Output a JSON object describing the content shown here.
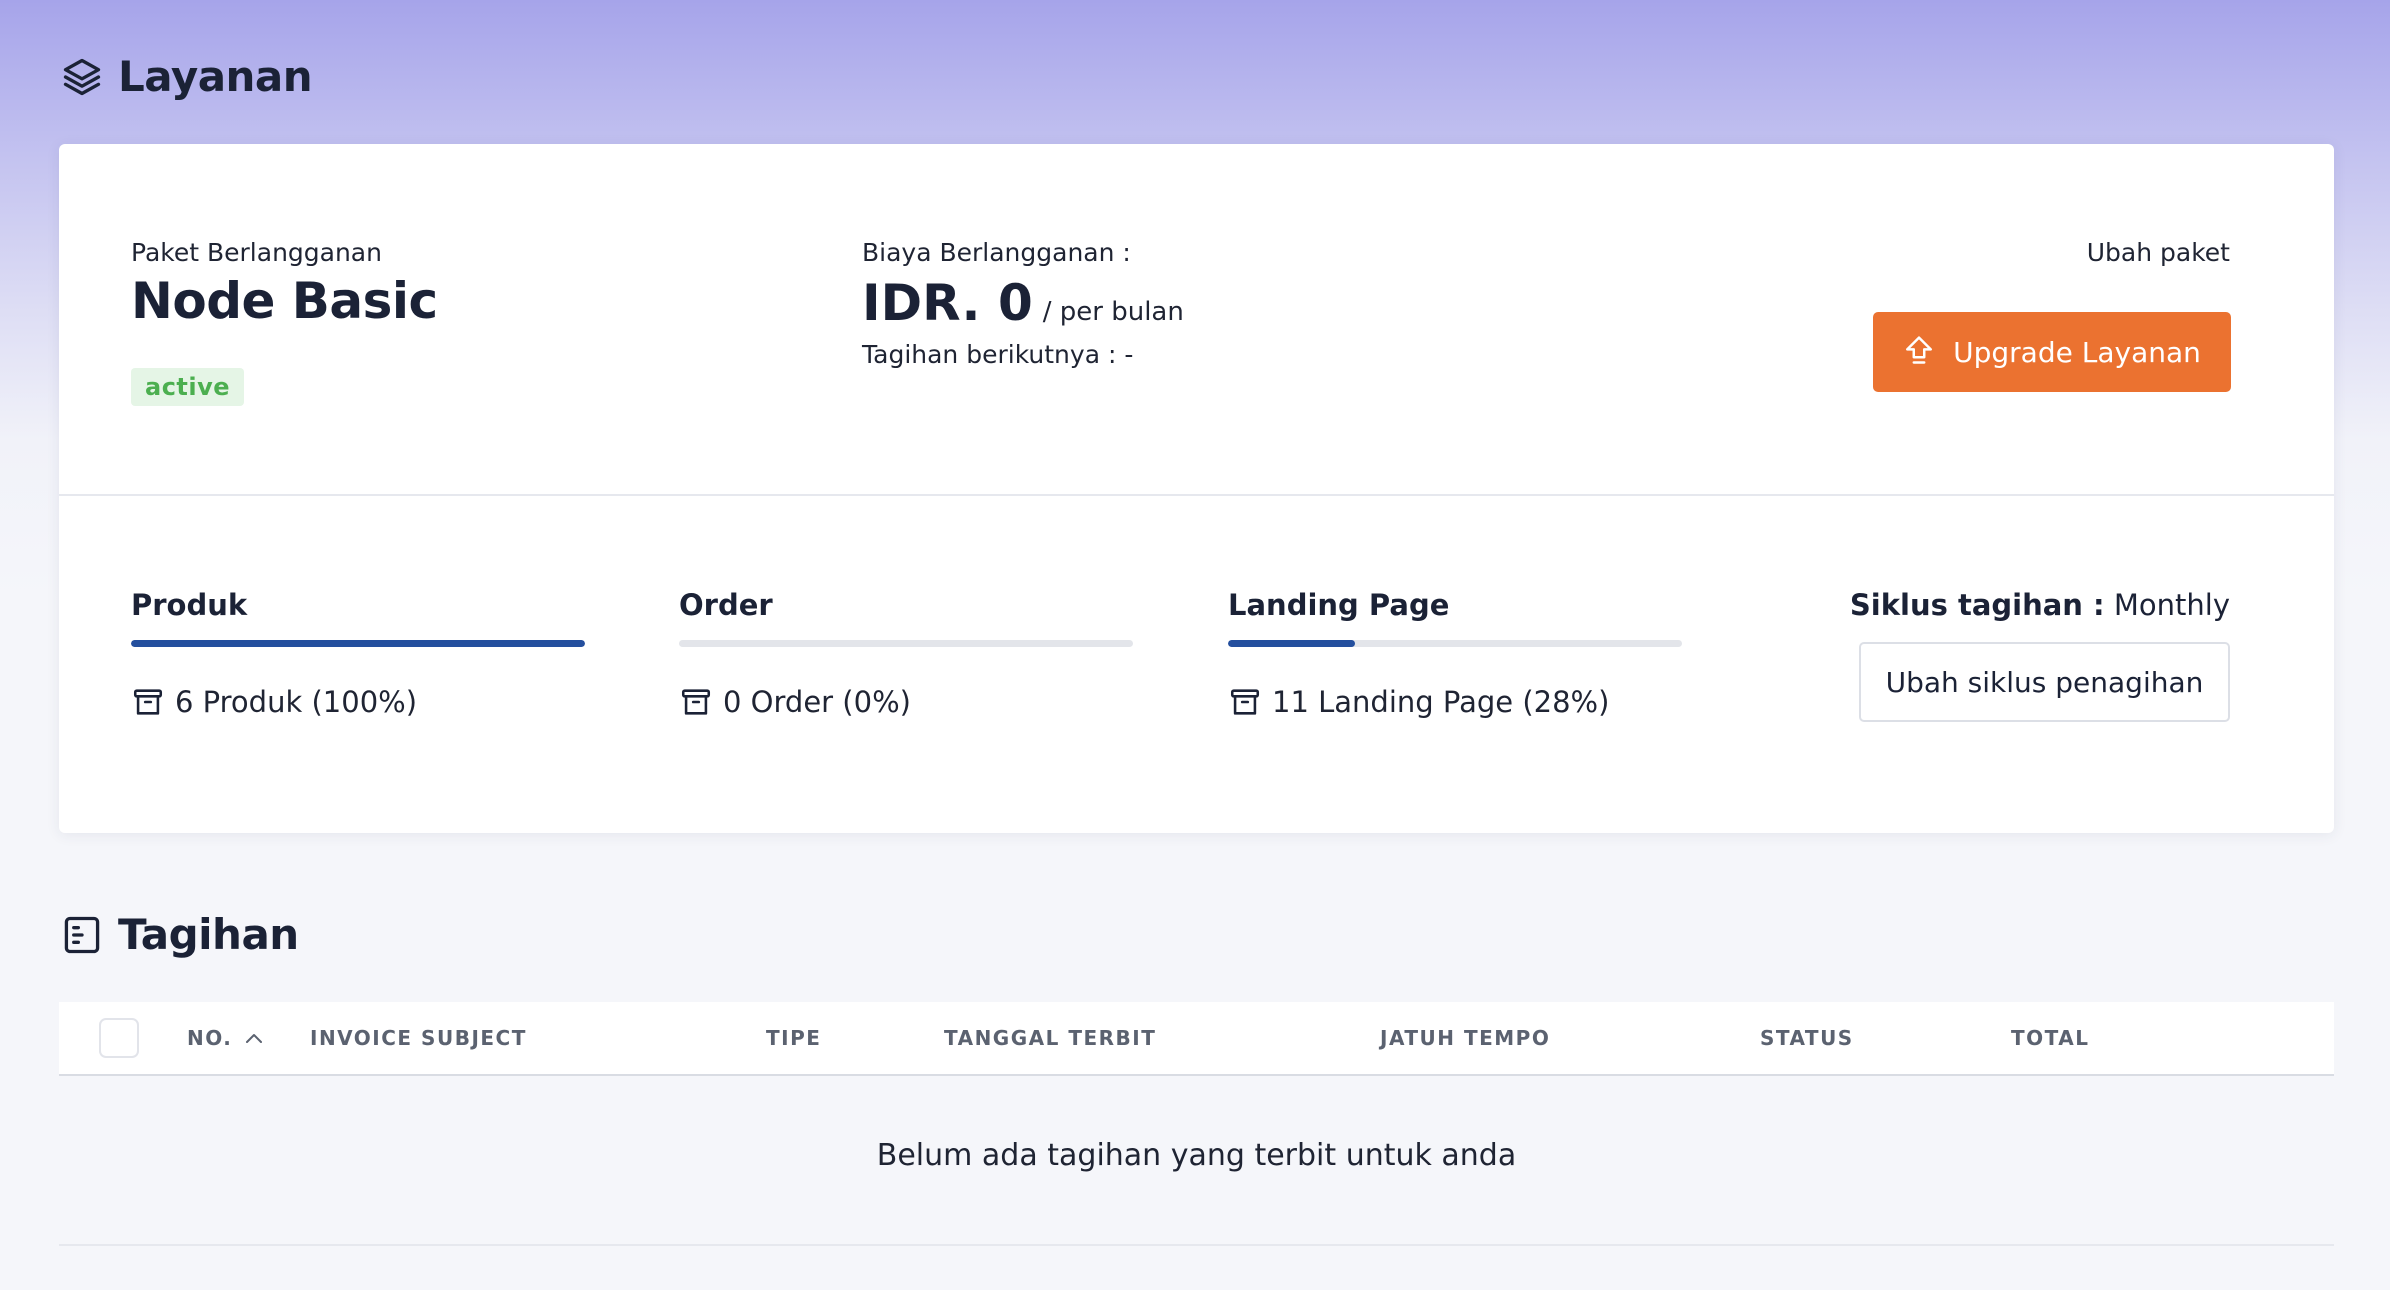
{
  "layanan": {
    "title": "Layanan",
    "plan_label": "Paket Berlangganan",
    "plan_name": "Node Basic",
    "status": "active",
    "fee_label": "Biaya Berlangganan :",
    "price": "IDR. 0",
    "period": "/ per bulan",
    "next_bill": "Tagihan berikutnya : -",
    "change_plan_label": "Ubah paket",
    "upgrade_button": "Upgrade Layanan",
    "metrics": [
      {
        "title": "Produk",
        "text": "6 Produk (100%)",
        "percent": 100
      },
      {
        "title": "Order",
        "text": "0 Order (0%)",
        "percent": 0
      },
      {
        "title": "Landing Page",
        "text": "11 Landing Page (28%)",
        "percent": 28
      }
    ],
    "cycle_label": "Siklus tagihan :",
    "cycle_value": "Monthly",
    "cycle_button": "Ubah siklus penagihan"
  },
  "tagihan": {
    "title": "Tagihan",
    "columns": [
      "NO.",
      "INVOICE SUBJECT",
      "TIPE",
      "TANGGAL TERBIT",
      "JATUH TEMPO",
      "STATUS",
      "TOTAL"
    ],
    "empty_message": "Belum ada tagihan yang terbit untuk anda"
  },
  "colors": {
    "accent": "#eb7230",
    "progress": "#244f9e",
    "badge_bg": "#e5f5e6",
    "badge_text": "#4caf50"
  },
  "icons": [
    "layers-icon",
    "receipt-icon",
    "archive-icon",
    "upload-arrow-icon",
    "chevron-up-icon"
  ]
}
